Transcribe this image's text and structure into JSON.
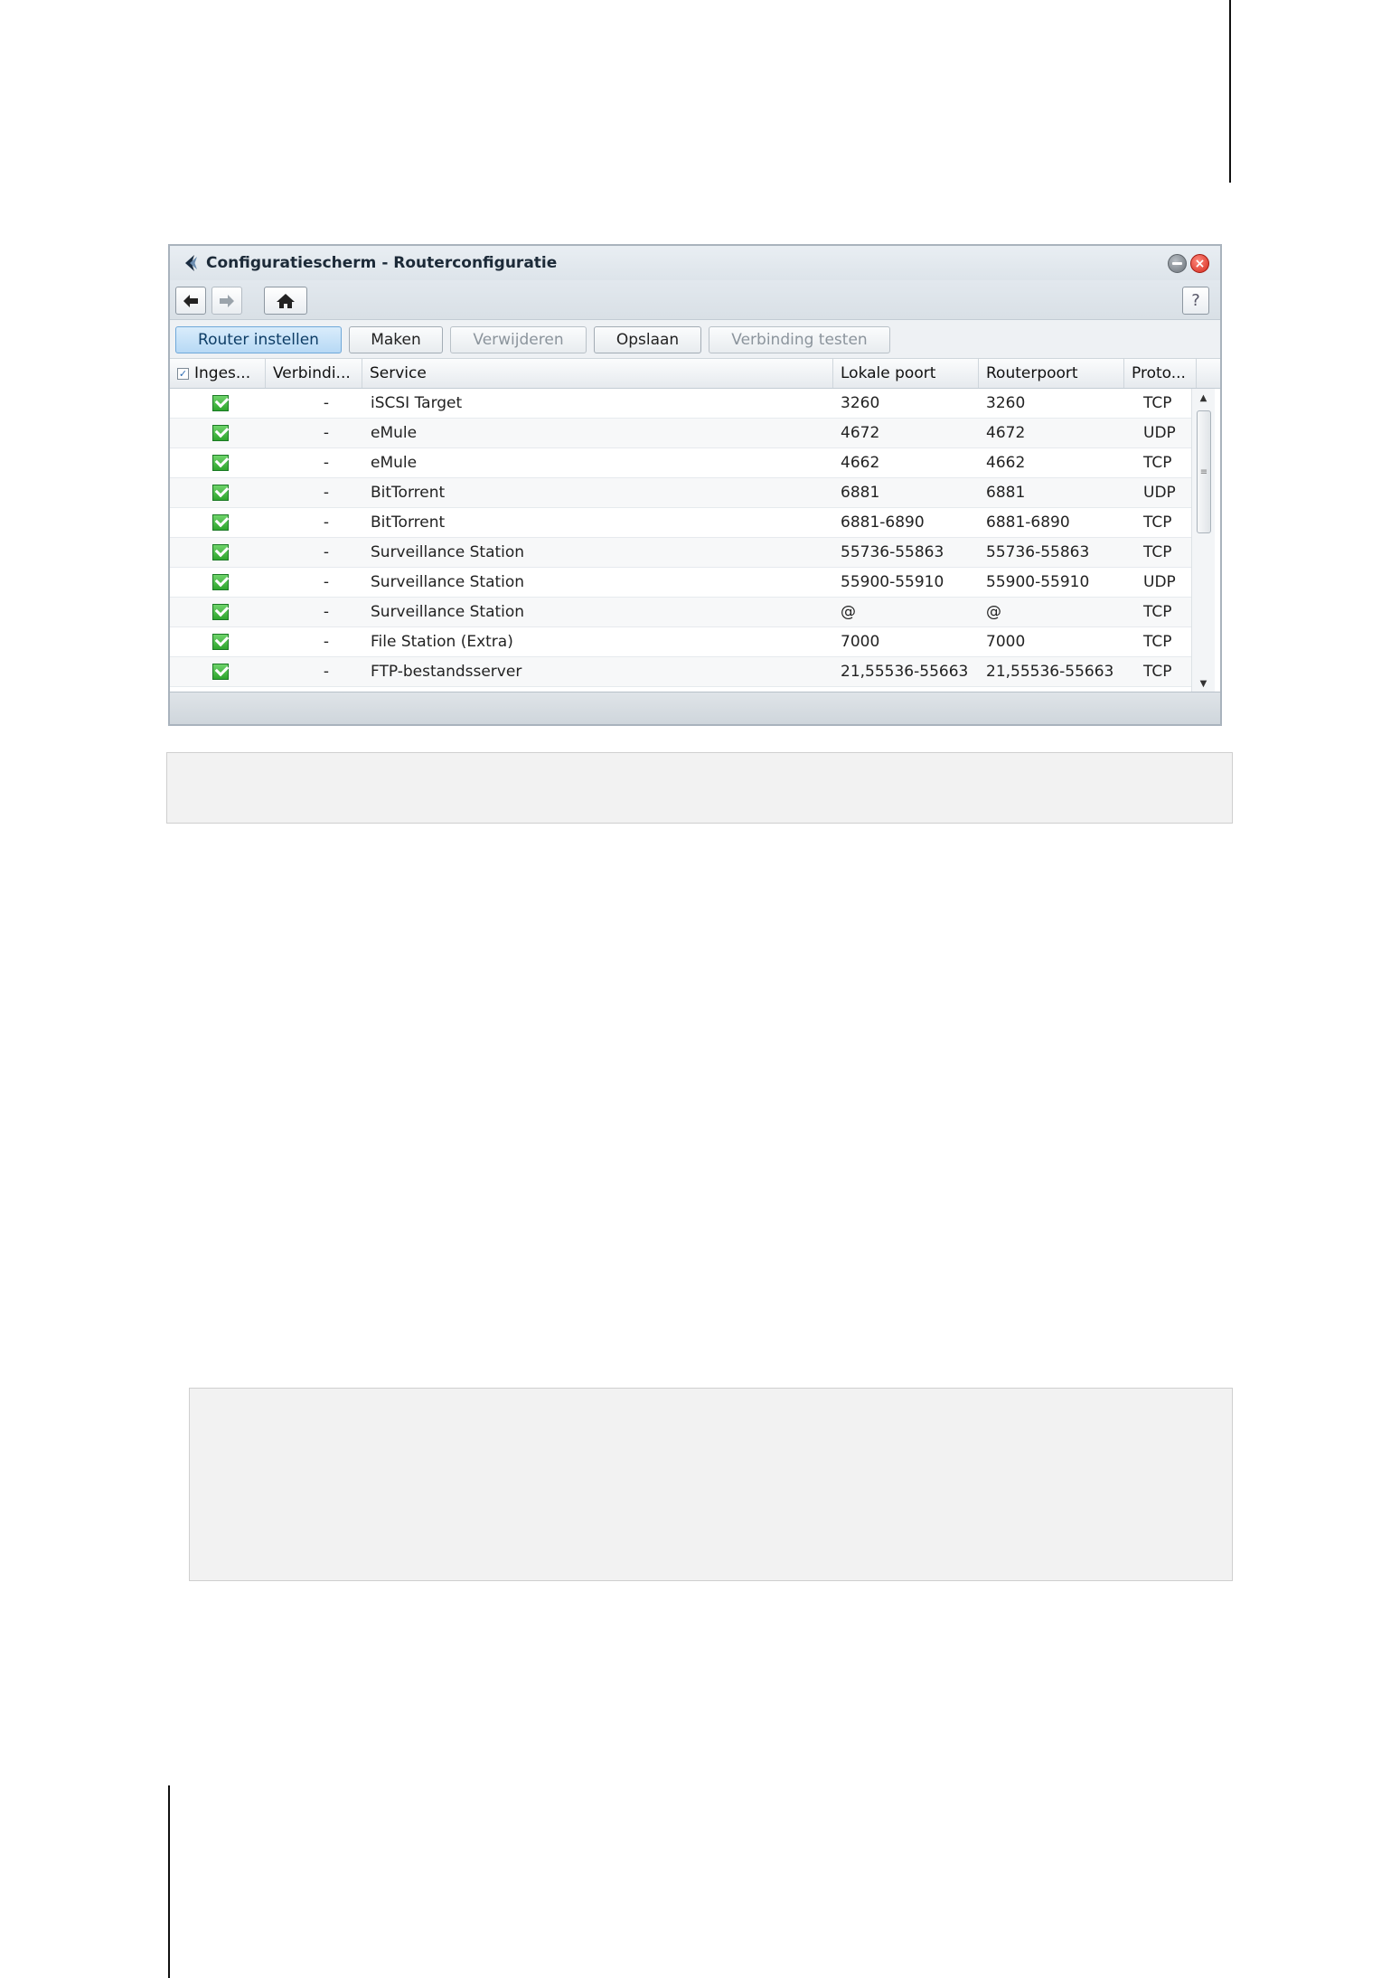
{
  "window": {
    "title": "Configuratiescherm - Routerconfiguratie",
    "close_glyph": "×",
    "help_label": "?"
  },
  "toolbar": {
    "buttons": [
      {
        "label": "Router instellen",
        "state": "active"
      },
      {
        "label": "Maken",
        "state": "enabled"
      },
      {
        "label": "Verwijderen",
        "state": "disabled"
      },
      {
        "label": "Opslaan",
        "state": "enabled"
      },
      {
        "label": "Verbinding testen",
        "state": "disabled"
      }
    ]
  },
  "grid": {
    "header_check": "✓",
    "columns": [
      "Inges...",
      "Verbindi...",
      "Service",
      "Lokale poort",
      "Routerpoort",
      "Proto..."
    ],
    "rows": [
      {
        "enabled": true,
        "connection": "-",
        "service": "iSCSI Target",
        "local_port": "3260",
        "router_port": "3260",
        "protocol": "TCP"
      },
      {
        "enabled": true,
        "connection": "-",
        "service": "eMule",
        "local_port": "4672",
        "router_port": "4672",
        "protocol": "UDP"
      },
      {
        "enabled": true,
        "connection": "-",
        "service": "eMule",
        "local_port": "4662",
        "router_port": "4662",
        "protocol": "TCP"
      },
      {
        "enabled": true,
        "connection": "-",
        "service": "BitTorrent",
        "local_port": "6881",
        "router_port": "6881",
        "protocol": "UDP"
      },
      {
        "enabled": true,
        "connection": "-",
        "service": "BitTorrent",
        "local_port": "6881-6890",
        "router_port": "6881-6890",
        "protocol": "TCP"
      },
      {
        "enabled": true,
        "connection": "-",
        "service": "Surveillance Station",
        "local_port": "55736-55863",
        "router_port": "55736-55863",
        "protocol": "TCP"
      },
      {
        "enabled": true,
        "connection": "-",
        "service": "Surveillance Station",
        "local_port": "55900-55910",
        "router_port": "55900-55910",
        "protocol": "UDP"
      },
      {
        "enabled": true,
        "connection": "-",
        "service": "Surveillance Station",
        "local_port": "@",
        "router_port": "@",
        "protocol": "TCP"
      },
      {
        "enabled": true,
        "connection": "-",
        "service": "File Station (Extra)",
        "local_port": "7000",
        "router_port": "7000",
        "protocol": "TCP"
      },
      {
        "enabled": true,
        "connection": "-",
        "service": "FTP-bestandsserver",
        "local_port": "21,55536-55663",
        "router_port": "21,55536-55663",
        "protocol": "TCP"
      }
    ]
  },
  "scrollbar": {
    "up_glyph": "▲",
    "down_glyph": "▼",
    "grip_glyph": "≡"
  },
  "icons": {
    "logo": "synology-logo-icon",
    "back": "arrow-left-icon",
    "forward": "arrow-right-icon",
    "home": "home-icon",
    "help": "question-icon",
    "minimize": "minimize-icon",
    "close": "close-icon",
    "row_check": "checkbox-checked-icon"
  },
  "colors": {
    "primary_button": "#b7d9f5",
    "checkbox_green": "#2ea52d",
    "close_red": "#d3281b"
  }
}
